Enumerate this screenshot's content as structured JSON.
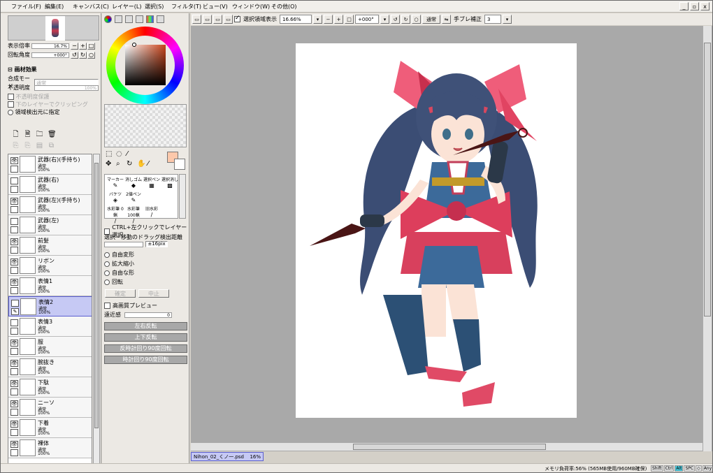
{
  "menu": [
    "ファイル(F)",
    "編集(E)",
    "キャンバス(C)",
    "レイヤー(L)",
    "選択(S)",
    "フィルタ(T)",
    "ビュー(V)",
    "ウィンドウ(W)",
    "その他(O)"
  ],
  "window_controls": [
    "_",
    "▫",
    "x"
  ],
  "toolbar": {
    "selection_show": "選択領域表示",
    "zoom": "16.66%",
    "angle": "+000°",
    "mode": "通常",
    "stabilizer_label": "手ブレ補正",
    "stabilizer": "3"
  },
  "left": {
    "zoom_label": "表示倍率",
    "zoom_value": "16.7%",
    "angle_label": "回転角度",
    "angle_value": "+000°",
    "paper_effect": "画材効果",
    "blend_label": "合成モード",
    "blend_value": "通常",
    "opacity_label": "不透明度",
    "opacity_value": "100%",
    "protect_opacity": "不透明度保護",
    "clip_lower": "下のレイヤーでクリッピング",
    "selection_source": "領域検出元に指定",
    "layers": [
      {
        "name": "武器(右)(手持ち)",
        "mode": "通常",
        "opacity": "100%",
        "visible": true
      },
      {
        "name": "武器(右)",
        "mode": "通常",
        "opacity": "100%",
        "visible": false
      },
      {
        "name": "武器(左)(手持ち)",
        "mode": "通常",
        "opacity": "100%",
        "visible": true
      },
      {
        "name": "武器(左)",
        "mode": "通常",
        "opacity": "100%",
        "visible": false
      },
      {
        "name": "前髪",
        "mode": "通常",
        "opacity": "100%",
        "visible": true
      },
      {
        "name": "リボン",
        "mode": "通常",
        "opacity": "100%",
        "visible": true
      },
      {
        "name": "表情1",
        "mode": "通常",
        "opacity": "100%",
        "visible": true
      },
      {
        "name": "表情2",
        "mode": "通常",
        "opacity": "100%",
        "visible": false,
        "selected": true
      },
      {
        "name": "表情3",
        "mode": "通常",
        "opacity": "100%",
        "visible": false
      },
      {
        "name": "服",
        "mode": "通常",
        "opacity": "100%",
        "visible": true
      },
      {
        "name": "腕抜き",
        "mode": "通常",
        "opacity": "100%",
        "visible": true
      },
      {
        "name": "下駄",
        "mode": "通常",
        "opacity": "100%",
        "visible": true
      },
      {
        "name": "ニーソ",
        "mode": "通常",
        "opacity": "100%",
        "visible": true
      },
      {
        "name": "下着",
        "mode": "通常",
        "opacity": "100%",
        "visible": true
      },
      {
        "name": "裸体",
        "mode": "通常",
        "opacity": "100%",
        "visible": true
      }
    ]
  },
  "mid": {
    "brushes": [
      {
        "label": "マーカー",
        "icon": "✎"
      },
      {
        "label": "消しゴム",
        "icon": "◆"
      },
      {
        "label": "選択ペン",
        "icon": "▦"
      },
      {
        "label": "選択消し",
        "icon": "▩"
      },
      {
        "label": "バケツ",
        "icon": "◈"
      },
      {
        "label": "2値ペン",
        "icon": "✎"
      },
      {
        "label": "",
        "icon": ""
      },
      {
        "label": "",
        "icon": ""
      },
      {
        "label": "水彩筆 0蝋",
        "icon": "/"
      },
      {
        "label": "水彩筆 100蝋",
        "icon": "/"
      },
      {
        "label": "旧水彩",
        "icon": "/"
      },
      {
        "label": "",
        "icon": ""
      }
    ],
    "ctrl_click": "CTRL+左クリックでレイヤー選択",
    "drag_distance": "選択・移動のドラッグ検出距離",
    "drag_value": "±16pix",
    "transforms": [
      "自由変形",
      "拡大縮小",
      "自由な形",
      "回転"
    ],
    "ok": "確定",
    "cancel": "中止",
    "hq_preview": "高画質プレビュー",
    "perspective_label": "遠近感",
    "perspective_value": "0",
    "flip_h": "左右反転",
    "flip_v": "上下反転",
    "rot_ccw": "反時計回り90度回転",
    "rot_cw": "時計回り90度回転"
  },
  "doc": {
    "name": "Nihon_02_くノ一.psd",
    "zoom": "16%"
  },
  "status": {
    "memory": "メモリ負荷率:56% (565MB使用/960MB確保)",
    "keys": [
      "Shift",
      "Ctrl",
      "Alt",
      "SPC",
      "◇",
      "Any",
      "✎"
    ]
  },
  "colors": {
    "accent": "#c6c9f4",
    "primary": "#fcc8ab",
    "secondary": "#ffffff"
  }
}
